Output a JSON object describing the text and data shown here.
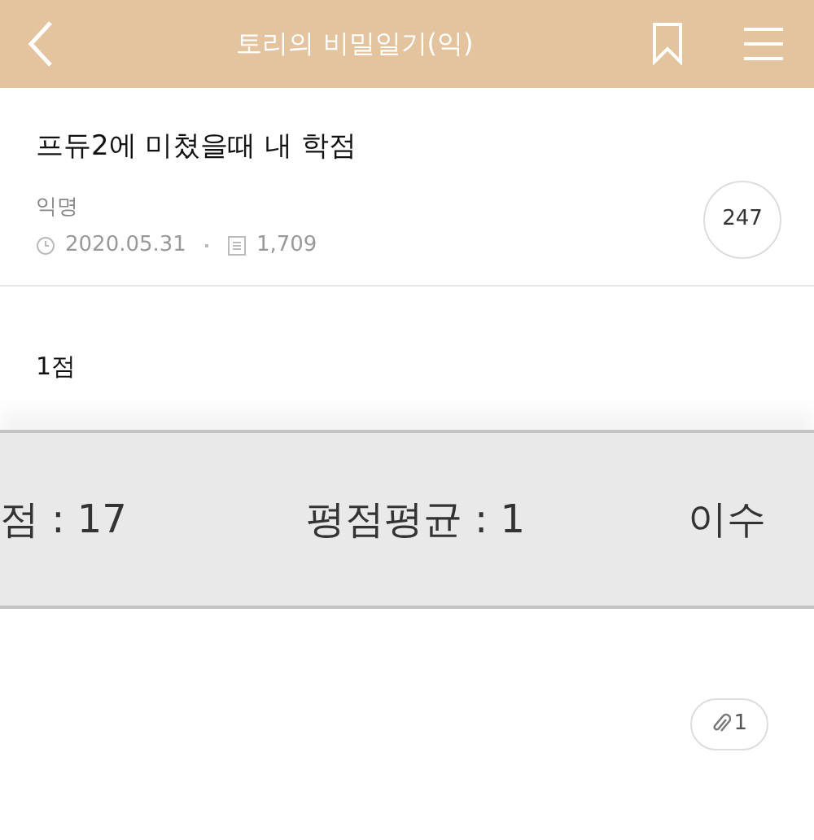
{
  "header": {
    "title": "토리의 비밀일기(익)"
  },
  "post": {
    "title": "프듀2에 미쳤을때 내 학점",
    "author": "익명",
    "date": "2020.05.31",
    "views": "1,709",
    "comments": "247",
    "body": "1점"
  },
  "image": {
    "texts": [
      "점 : 17",
      "평점평균 : 1",
      "이수"
    ]
  },
  "attachment": {
    "count": "1"
  }
}
